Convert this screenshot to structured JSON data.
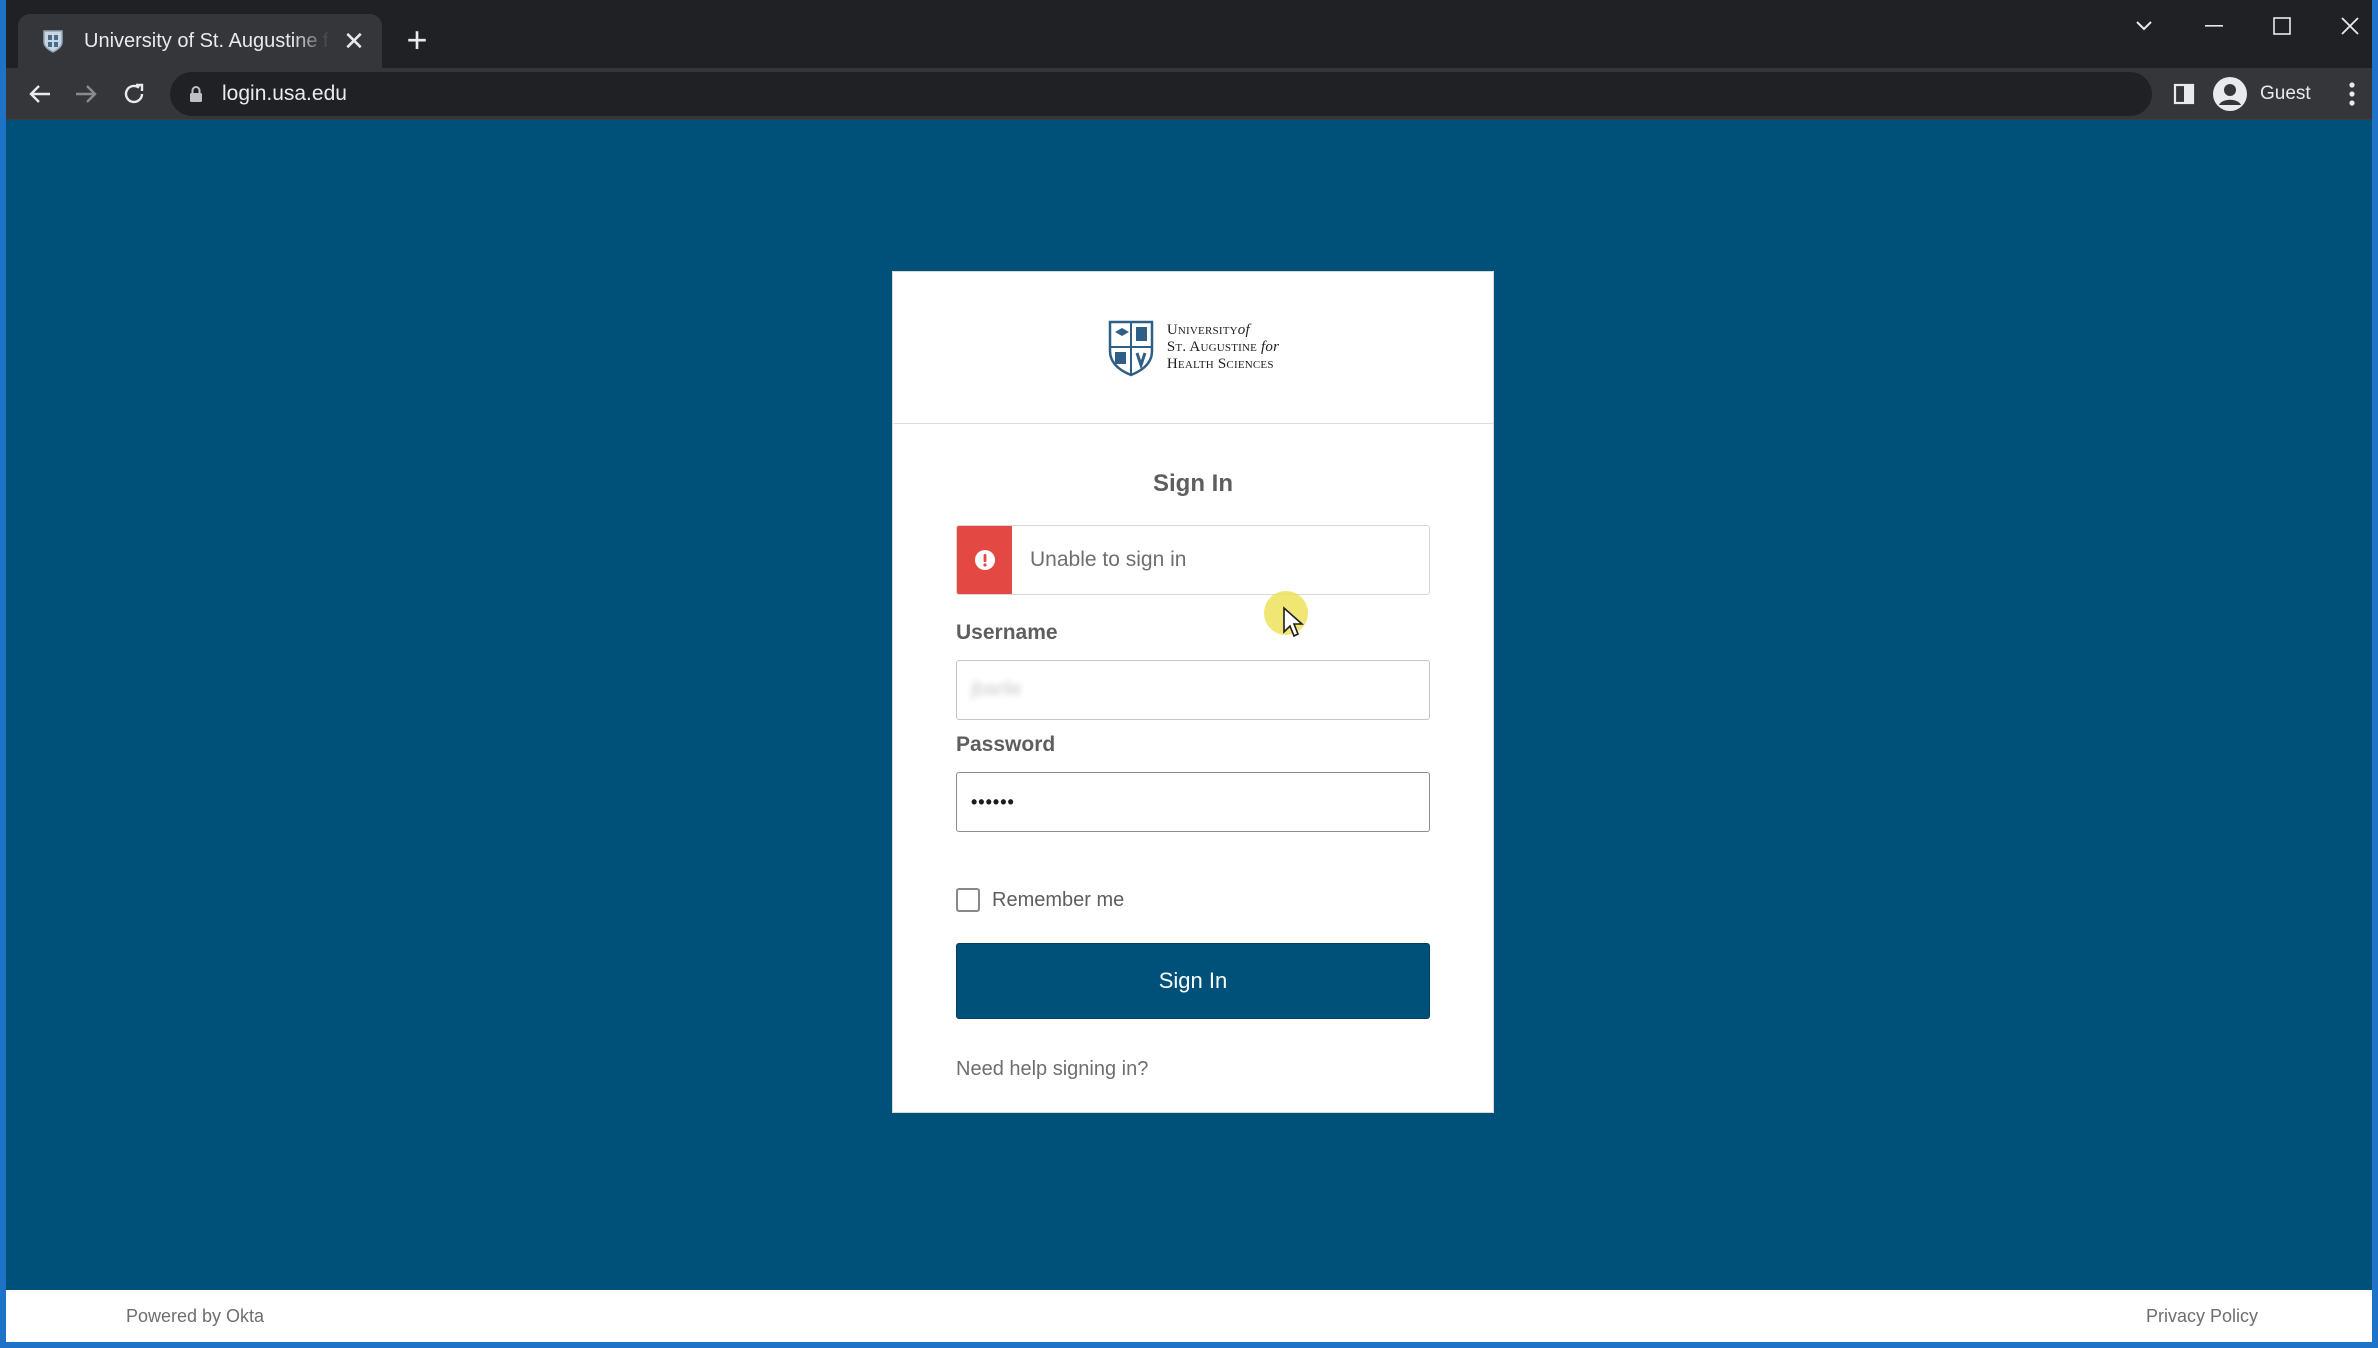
{
  "browser": {
    "tab_title": "University of St. Augustine for Health Sciences",
    "url": "login.usa.edu",
    "profile_label": "Guest",
    "new_tab_symbol": "+",
    "close_symbol": "✕"
  },
  "logo": {
    "line1a": "University",
    "line1b": "of",
    "line2a": "St. Augustine",
    "line2b": "for",
    "line3": "Health Sciences"
  },
  "form": {
    "title": "Sign In",
    "error_message": "Unable to sign in",
    "username_label": "Username",
    "username_value": "jbarile",
    "password_label": "Password",
    "password_value": "••••••",
    "remember_label": "Remember me",
    "remember_checked": false,
    "submit_label": "Sign In",
    "help_link": "Need help signing in?"
  },
  "footer": {
    "powered_by": "Powered by Okta",
    "privacy": "Privacy Policy"
  },
  "colors": {
    "background": "#00517a",
    "error": "#e34843",
    "button": "#00517a"
  }
}
